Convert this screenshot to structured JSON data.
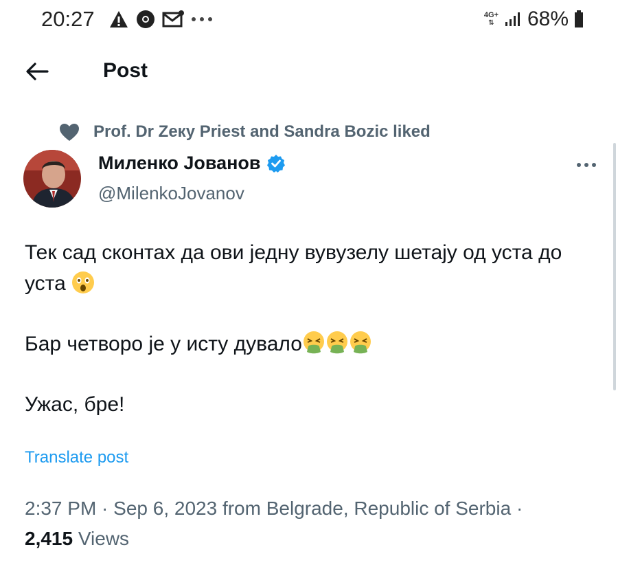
{
  "status_bar": {
    "time": "20:27",
    "icons": [
      "warning-icon",
      "chrome-icon",
      "mail-icon",
      "more-notifications-icon"
    ],
    "network": "4G+",
    "battery": "68%"
  },
  "header": {
    "title": "Post",
    "back_icon": "arrow-left-icon"
  },
  "social_context": {
    "icon": "heart-icon",
    "text": "Prof. Dr Zeкy Priest and Sandra Bozic liked"
  },
  "author": {
    "name": "Миленко Јованов",
    "handle": "@MilenkoJovanov",
    "verified": true
  },
  "tweet": {
    "line1": "Тек сад сконтах да ови једну вувузелу шетају од уста до уста",
    "line2": "Бар четворо је у исту дувало",
    "line3": "Ужас, бре!",
    "emoji_line1": [
      "astonished-face"
    ],
    "emoji_line2": [
      "vomiting-face",
      "vomiting-face",
      "vomiting-face"
    ]
  },
  "translate_label": "Translate post",
  "meta": {
    "datetime": "2:37 PM · Sep 6, 2023 from Belgrade, Republic of Serbia ·",
    "views_count": "2,415",
    "views_label": "Views"
  },
  "colors": {
    "accent": "#1d9bf0",
    "secondary_text": "#536471",
    "primary_text": "#0f1419"
  }
}
